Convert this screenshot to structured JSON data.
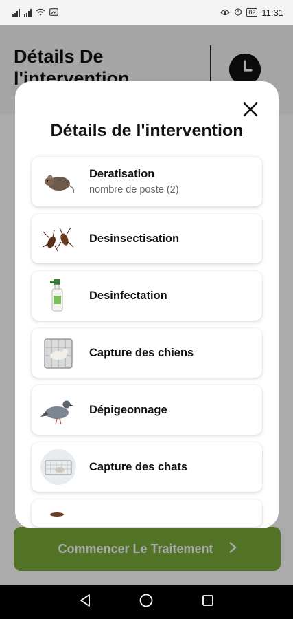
{
  "status_bar": {
    "left_indicators": [
      "4G",
      "4G"
    ],
    "battery": "82",
    "time": "11:31"
  },
  "background_page": {
    "title": "Détails De l'intervention",
    "start_button_label": "Commencer Le Traitement"
  },
  "modal": {
    "title": "Détails de l'intervention",
    "items": [
      {
        "name": "Deratisation",
        "sub": "nombre de poste (2)",
        "icon": "rat-icon"
      },
      {
        "name": "Desinsectisation",
        "sub": "",
        "icon": "cockroach-icon"
      },
      {
        "name": "Desinfectation",
        "sub": "",
        "icon": "spray-bottle-icon"
      },
      {
        "name": "Capture des chiens",
        "sub": "",
        "icon": "dog-cage-icon"
      },
      {
        "name": "Dépigeonnage",
        "sub": "",
        "icon": "pigeon-icon"
      },
      {
        "name": "Capture des chats",
        "sub": "",
        "icon": "cat-trap-icon"
      }
    ]
  },
  "colors": {
    "accent_green": "#7bac3a",
    "overlay": "rgba(0,0,0,0.33)"
  }
}
